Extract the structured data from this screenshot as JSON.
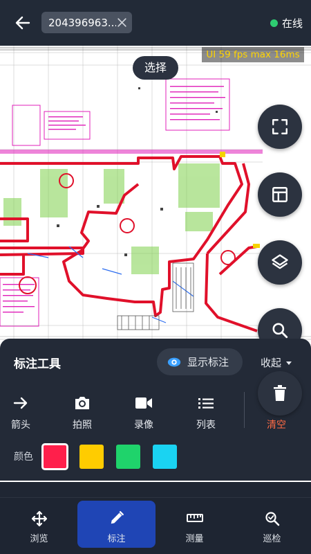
{
  "header": {
    "document_name": "204396963...",
    "status_text": "在线",
    "status_color": "#2ecc71"
  },
  "canvas": {
    "fps_text": "UI 59 fps  max 16ms",
    "mode_label": "选择"
  },
  "floating_buttons": [
    "fullscreen-icon",
    "layout-icon",
    "layers-icon",
    "search-icon",
    "delete-icon"
  ],
  "panel": {
    "title": "标注工具",
    "toggle_label": "显示标注",
    "collapse_label": "收起",
    "tools": [
      {
        "label": "箭头",
        "icon": "arrow-right-icon"
      },
      {
        "label": "拍照",
        "icon": "camera-icon"
      },
      {
        "label": "录像",
        "icon": "video-icon"
      },
      {
        "label": "列表",
        "icon": "list-icon"
      },
      {
        "label": "清空",
        "icon": "trash-icon"
      }
    ],
    "color_label": "颜色",
    "colors": [
      "#ff1f4b",
      "#ffcc00",
      "#1fd36b",
      "#1ad3f2"
    ],
    "selected_color_index": 0
  },
  "bottom_nav": [
    {
      "label": "浏览",
      "icon": "move-icon"
    },
    {
      "label": "标注",
      "icon": "pencil-icon"
    },
    {
      "label": "测量",
      "icon": "ruler-icon"
    },
    {
      "label": "巡检",
      "icon": "inspect-icon"
    }
  ],
  "bottom_nav_active_index": 1,
  "theme": {
    "accent": "#1f45b5",
    "danger": "#ff6b45",
    "toggle_eye": "#3aa0ff"
  }
}
